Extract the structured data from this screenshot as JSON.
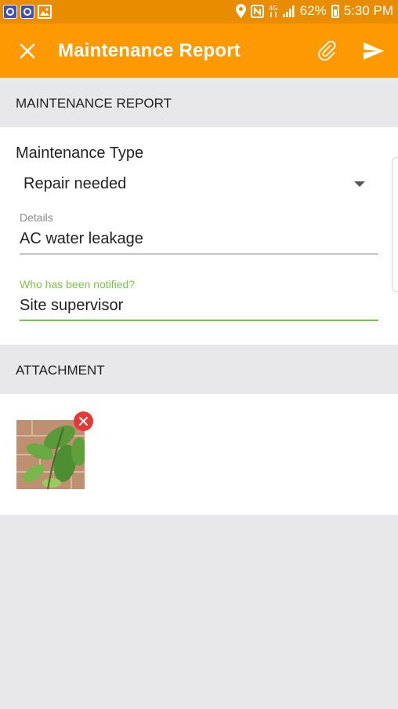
{
  "status_bar": {
    "battery": "62%",
    "time": "5:30 PM",
    "icons": [
      "app-notification-icon",
      "app-notification-icon",
      "gallery-icon",
      "location-icon",
      "nfc-icon",
      "data-icon",
      "signal-icon",
      "battery-icon"
    ]
  },
  "app_bar": {
    "title": "Maintenance Report",
    "icons": [
      "close-icon",
      "paperclip-icon",
      "send-icon"
    ],
    "color": "#fc9903"
  },
  "sections": {
    "report_header": "MAINTENANCE REPORT",
    "attachment_header": "ATTACHMENT"
  },
  "form": {
    "maintenance_type_label": "Maintenance Type",
    "maintenance_type_value": "Repair needed",
    "details_label": "Details",
    "details_value": "AC water leakage",
    "notified_label": "Who has been notified?",
    "notified_value": "Site supervisor",
    "active_color": "#7cc04b"
  },
  "attachments": [
    {
      "type": "image",
      "icon": "plant-photo-thumbnail"
    }
  ]
}
